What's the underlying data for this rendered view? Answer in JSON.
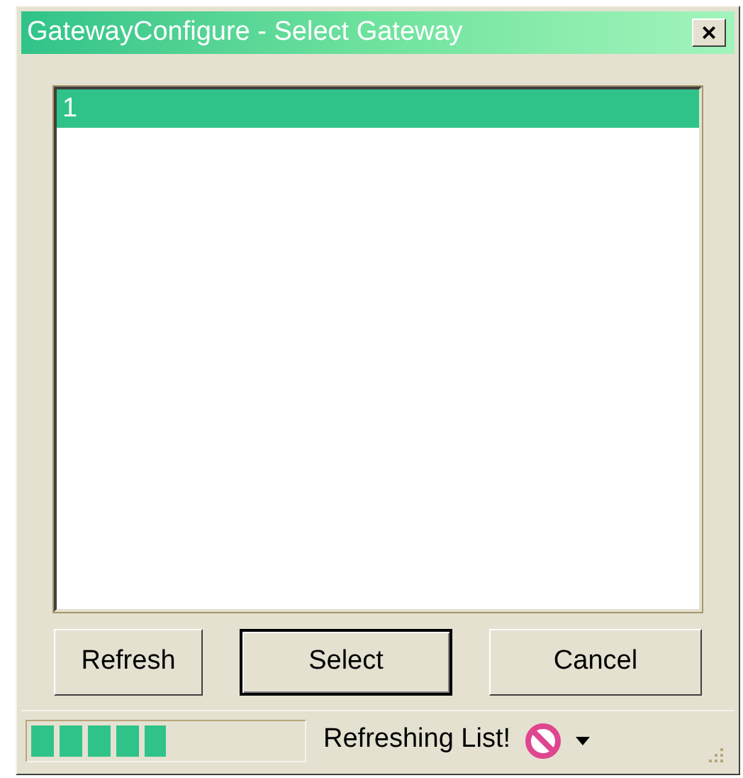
{
  "window": {
    "title": "GatewayConfigure - Select Gateway",
    "close": "×"
  },
  "list": {
    "items": [
      {
        "label": "1",
        "selected": true
      }
    ]
  },
  "buttons": [
    {
      "label": "Refresh",
      "default": false
    },
    {
      "label": "Select",
      "default": true
    },
    {
      "label": "Cancel",
      "default": false
    }
  ],
  "status_bar": {
    "level": 0.5,
    "message": "Refreshing List!"
  }
}
